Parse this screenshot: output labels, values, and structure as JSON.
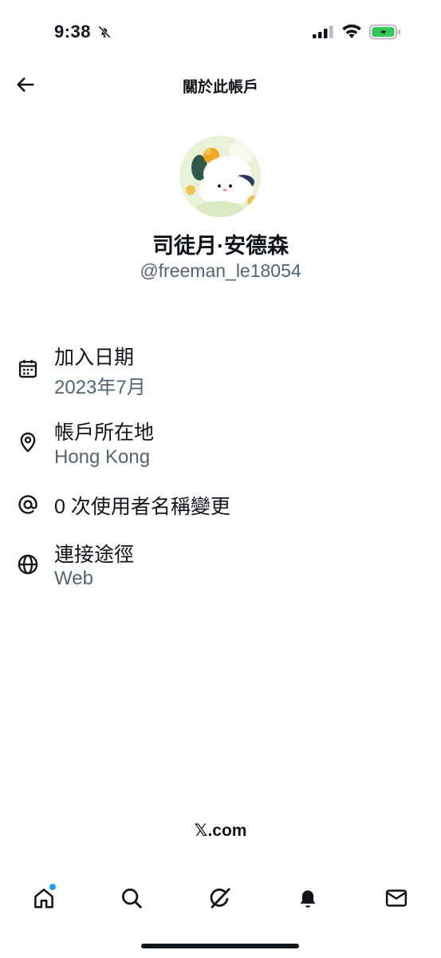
{
  "status_bar": {
    "time": "9:38"
  },
  "header": {
    "title": "關於此帳戶"
  },
  "profile": {
    "display_name": "司徒月·安德森",
    "handle": "@freeman_le18054"
  },
  "info_rows": [
    {
      "icon": "calendar-icon",
      "label": "加入日期",
      "value": "2023年7月"
    },
    {
      "icon": "location-pin-icon",
      "label": "帳戶所在地",
      "value": "Hong Kong"
    },
    {
      "icon": "at-sign-icon",
      "label": "0 次使用者名稱變更"
    },
    {
      "icon": "globe-icon",
      "label": "連接途徑",
      "value": "Web"
    }
  ],
  "footer": {
    "brand": "𝕏.com"
  },
  "tab_bar": [
    "home-icon",
    "search-icon",
    "grok-icon",
    "notifications-bell-icon",
    "messages-icon"
  ],
  "colors": {
    "secondary_text": "#536471",
    "accent": "#1d9bf0",
    "primary_text": "#0f1419"
  }
}
